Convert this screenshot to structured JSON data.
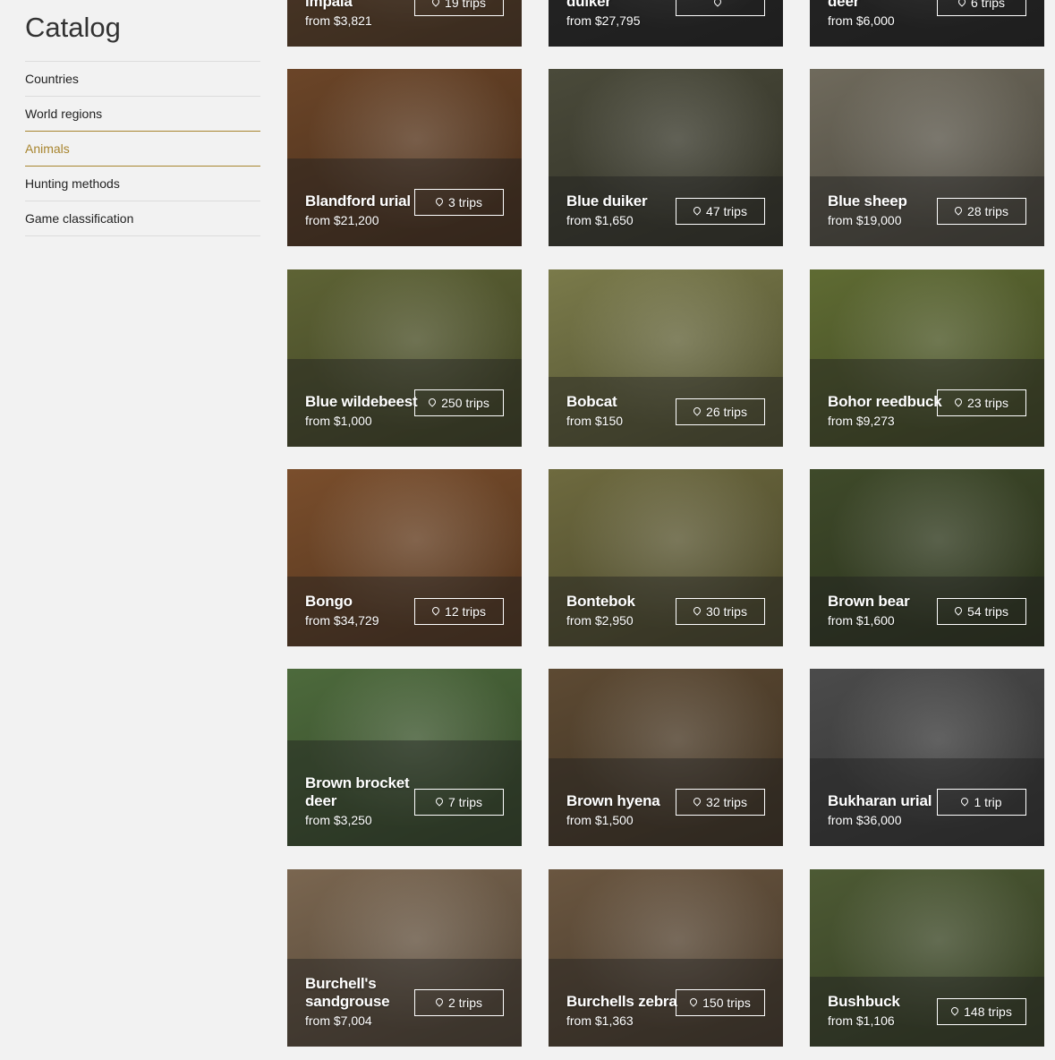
{
  "sidebar": {
    "title": "Catalog",
    "items": [
      {
        "label": "Countries",
        "active": false
      },
      {
        "label": "World regions",
        "active": false
      },
      {
        "label": "Animals",
        "active": true
      },
      {
        "label": "Hunting methods",
        "active": false
      },
      {
        "label": "Game classification",
        "active": false
      }
    ]
  },
  "cards": [
    {
      "name": "impala",
      "price": "from $3,821",
      "trips": "19 trips",
      "icon": "pin-icon",
      "bg": "#7a5230"
    },
    {
      "name": "duiker",
      "price": "from $27,795",
      "trips": "",
      "icon": "pin-icon",
      "bg": "#2e2e2e"
    },
    {
      "name": "deer",
      "price": "from $6,000",
      "trips": "6 trips",
      "icon": "pin-icon",
      "bg": "#2e2e2e"
    },
    {
      "name": "Blandford urial",
      "price": "from $21,200",
      "trips": "3 trips",
      "icon": "pin-icon",
      "bg": "#6b4528"
    },
    {
      "name": "Blue duiker",
      "price": "from $1,650",
      "trips": "47 trips",
      "icon": "pin-icon",
      "bg": "#4a4a3a"
    },
    {
      "name": "Blue sheep",
      "price": "from $19,000",
      "trips": "28 trips",
      "icon": "pin-icon",
      "bg": "#6f6a5c"
    },
    {
      "name": "Blue wildebeest",
      "price": "from $1,000",
      "trips": "250 trips",
      "icon": "pin-icon",
      "bg": "#5e6335"
    },
    {
      "name": "Bobcat",
      "price": "from $150",
      "trips": "26 trips",
      "icon": "pin-icon",
      "bg": "#7a7a4a"
    },
    {
      "name": "Bohor reedbuck",
      "price": "from $9,273",
      "trips": "23 trips",
      "icon": "pin-icon",
      "bg": "#5f6b33"
    },
    {
      "name": "Bongo",
      "price": "from $34,729",
      "trips": "12 trips",
      "icon": "pin-icon",
      "bg": "#7a4e2c"
    },
    {
      "name": "Bontebok",
      "price": "from $2,950",
      "trips": "30 trips",
      "icon": "pin-icon",
      "bg": "#6e6a3f"
    },
    {
      "name": "Brown bear",
      "price": "from $1,600",
      "trips": "54 trips",
      "icon": "pin-icon",
      "bg": "#3f4a2a"
    },
    {
      "name": "Brown brocket deer",
      "price": "from $3,250",
      "trips": "7 trips",
      "icon": "pin-icon",
      "bg": "#4d6a3c"
    },
    {
      "name": "Brown hyena",
      "price": "from $1,500",
      "trips": "32 trips",
      "icon": "pin-icon",
      "bg": "#5d4a33"
    },
    {
      "name": "Bukharan urial",
      "price": "from $36,000",
      "trips": "1 trip",
      "icon": "pin-icon",
      "bg": "#4b4b4b"
    },
    {
      "name": "Burchell's sandgrouse",
      "price": "from $7,004",
      "trips": "2 trips",
      "icon": "pin-icon",
      "bg": "#7a6650"
    },
    {
      "name": "Burchells zebra",
      "price": "from $1,363",
      "trips": "150 trips",
      "icon": "pin-icon",
      "bg": "#6a5640"
    },
    {
      "name": "Bushbuck",
      "price": "from $1,106",
      "trips": "148 trips",
      "icon": "pin-icon",
      "bg": "#4d5a34"
    }
  ]
}
